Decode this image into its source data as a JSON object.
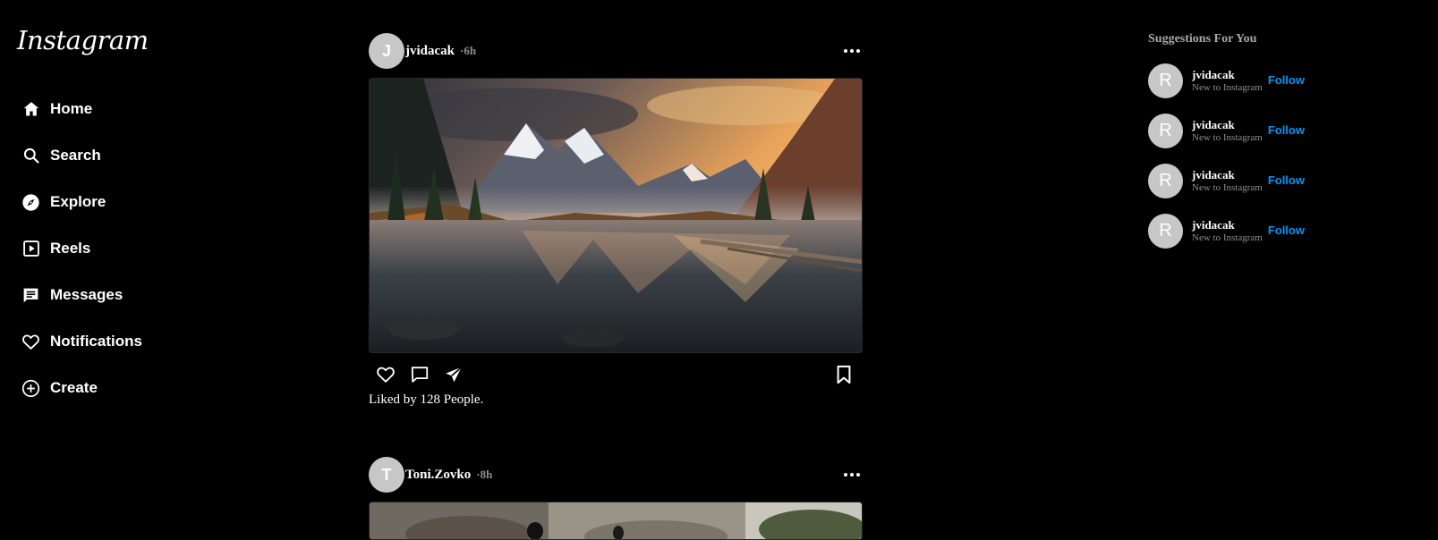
{
  "brand": {
    "logo_text": "Instagram"
  },
  "nav": {
    "items": [
      {
        "label": "Home",
        "icon": "home-icon"
      },
      {
        "label": "Search",
        "icon": "search-icon"
      },
      {
        "label": "Explore",
        "icon": "compass-icon"
      },
      {
        "label": "Reels",
        "icon": "reels-icon"
      },
      {
        "label": "Messages",
        "icon": "message-icon"
      },
      {
        "label": "Notifications",
        "icon": "heart-icon"
      },
      {
        "label": "Create",
        "icon": "plus-circle-icon"
      }
    ]
  },
  "posts": [
    {
      "avatar_letter": "J",
      "username": "jvidacak",
      "time": "·6h",
      "likes_text": "Liked by 128 People.",
      "image": "mountain-lake-sunset"
    },
    {
      "avatar_letter": "T",
      "username": "Toni.Zovko",
      "time": "·8h",
      "image": "forest-motorcycle"
    }
  ],
  "suggestions": {
    "title": "Suggestions For You",
    "follow_label": "Follow",
    "items": [
      {
        "avatar_letter": "R",
        "username": "jvidacak",
        "subtitle": "New to Instagram"
      },
      {
        "avatar_letter": "R",
        "username": "jvidacak",
        "subtitle": "New to Instagram"
      },
      {
        "avatar_letter": "R",
        "username": "jvidacak",
        "subtitle": "New to Instagram"
      },
      {
        "avatar_letter": "R",
        "username": "jvidacak",
        "subtitle": "New to Instagram"
      }
    ]
  },
  "colors": {
    "background": "#000000",
    "accent": "#0095f6",
    "muted": "#8e8e8e",
    "avatar": "#c7c7c7"
  }
}
